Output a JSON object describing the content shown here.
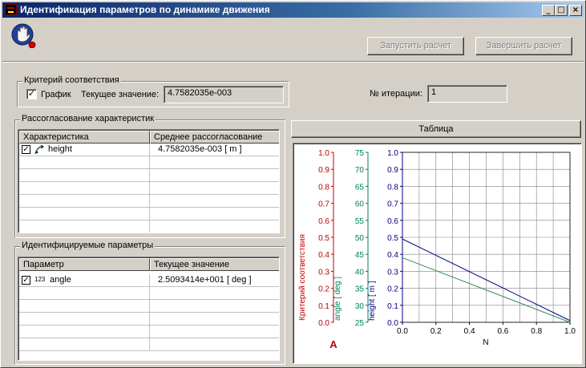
{
  "window": {
    "title": "Идентификация параметров по динамике движения",
    "controls": {
      "minimize": "_",
      "maximize": "□",
      "close": "×"
    }
  },
  "toolbar": {
    "app_icon": "hand-icon",
    "start_button": "Запустить расчет",
    "finish_button": "Завершить расчет"
  },
  "criterion": {
    "group_label": "Критерий соответствия",
    "graph_checkbox_label": "График",
    "graph_checked": true,
    "current_value_label": "Текущее значение:",
    "current_value": "4.7582035e-003"
  },
  "iteration": {
    "label": "№ итерации:",
    "value": "1"
  },
  "mismatch": {
    "group_label": "Рассогласование характеристик",
    "columns": [
      "Характеристика",
      "Среднее рассогласование"
    ],
    "rows": [
      {
        "checked": true,
        "icon": "trajectory-icon",
        "name": "height",
        "value": "4.7582035e-003  [ m ]"
      }
    ]
  },
  "params": {
    "group_label": "Идентифицируемые параметры",
    "columns": [
      "Параметр",
      "Текущее значение"
    ],
    "rows": [
      {
        "checked": true,
        "icon": "number-icon",
        "icon_text": "123",
        "name": "angle",
        "value": "2.5093414e+001  [ deg ]"
      }
    ]
  },
  "table_button": "Таблица",
  "chart_marker": "A",
  "chart_data": {
    "type": "line",
    "x_axis": {
      "label": "N",
      "range": [
        0,
        1.0
      ],
      "ticks": [
        "0.0",
        "0.2",
        "0.4",
        "0.6",
        "0.8",
        "1.0"
      ]
    },
    "y_axes": [
      {
        "label": "Критерий соответствия",
        "range": [
          0,
          1.0
        ],
        "ticks": [
          "0.0",
          "0.1",
          "0.2",
          "0.3",
          "0.4",
          "0.5",
          "0.6",
          "0.7",
          "0.8",
          "0.9",
          "1.0"
        ],
        "color": "#c00000"
      },
      {
        "label": "angle  [ deg ]",
        "range": [
          25,
          75
        ],
        "ticks": [
          "25",
          "30",
          "35",
          "40",
          "45",
          "50",
          "55",
          "60",
          "65",
          "70",
          "75"
        ],
        "color": "#008060"
      },
      {
        "label": "height  [ m ]",
        "range": [
          0,
          1.0
        ],
        "ticks": [
          "0.0",
          "0.1",
          "0.2",
          "0.3",
          "0.4",
          "0.5",
          "0.6",
          "0.7",
          "0.8",
          "0.9",
          "1.0"
        ],
        "color": "#000080"
      }
    ],
    "series": [
      {
        "name": "height",
        "axis": 2,
        "color": "#000080",
        "x": [
          0.0,
          1.0
        ],
        "y": [
          0.49,
          0.01
        ]
      },
      {
        "name": "angle",
        "axis": 1,
        "color": "#2e8b57",
        "x": [
          0.0,
          1.0
        ],
        "y": [
          44.0,
          25.0
        ]
      }
    ],
    "grid": true
  }
}
